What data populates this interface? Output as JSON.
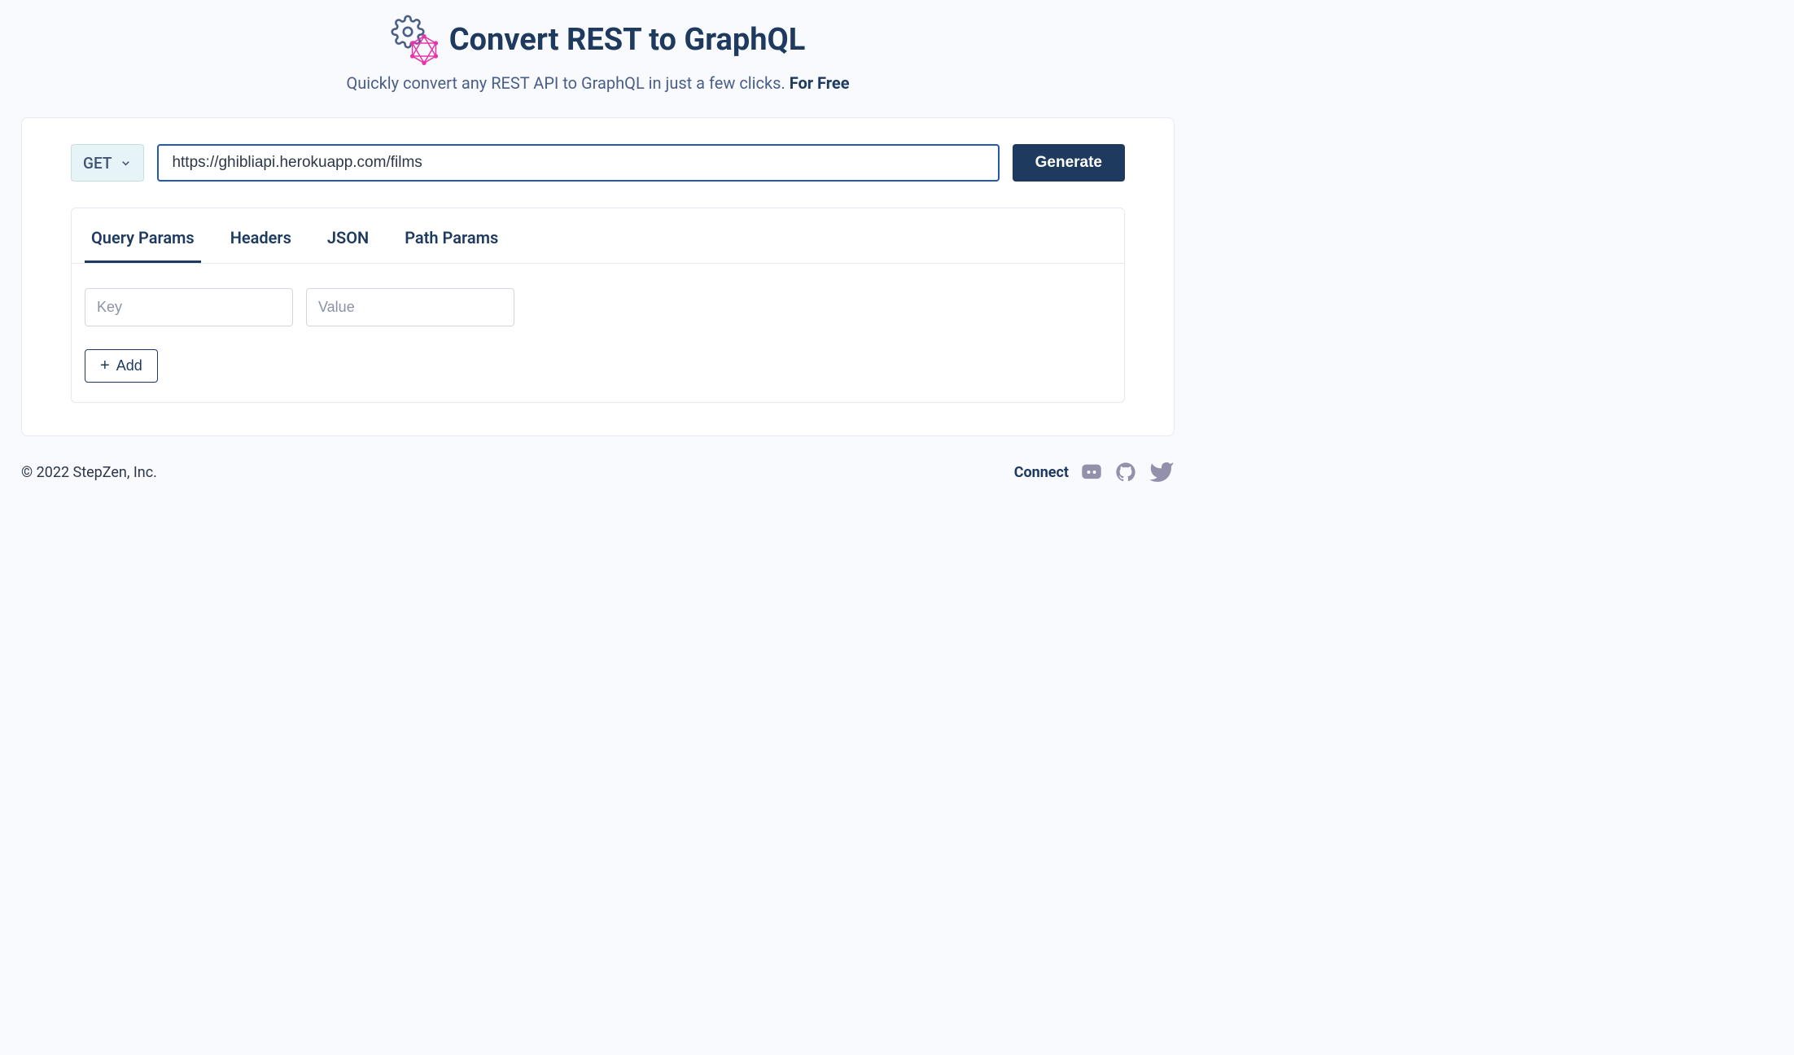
{
  "header": {
    "title": "Convert REST to GraphQL",
    "subtitle_prefix": "Quickly convert any REST API to GraphQL in just a few clicks. ",
    "subtitle_emphasis": "For Free"
  },
  "request": {
    "method": "GET",
    "url": "https://ghibliapi.herokuapp.com/films",
    "generate_label": "Generate"
  },
  "tabs": [
    {
      "id": "query-params",
      "label": "Query Params",
      "active": true
    },
    {
      "id": "headers",
      "label": "Headers",
      "active": false
    },
    {
      "id": "json",
      "label": "JSON",
      "active": false
    },
    {
      "id": "path-params",
      "label": "Path Params",
      "active": false
    }
  ],
  "params": {
    "key_placeholder": "Key",
    "value_placeholder": "Value",
    "add_label": "Add"
  },
  "footer": {
    "copyright": "© 2022 StepZen, Inc.",
    "connect_label": "Connect"
  }
}
